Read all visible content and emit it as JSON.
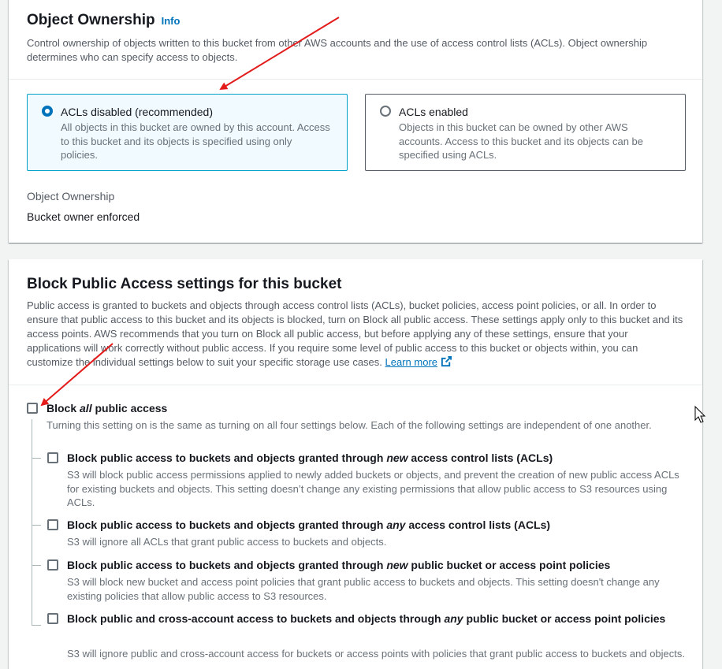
{
  "ownership": {
    "title": "Object Ownership",
    "info_label": "Info",
    "description": "Control ownership of objects written to this bucket from other AWS accounts and the use of access control lists (ACLs). Object ownership determines who can specify access to objects.",
    "options": [
      {
        "label": "ACLs disabled (recommended)",
        "description": "All objects in this bucket are owned by this account. Access to this bucket and its objects is specified using only policies.",
        "selected": true
      },
      {
        "label": "ACLs enabled",
        "description": "Objects in this bucket can be owned by other AWS accounts. Access to this bucket and its objects can be specified using ACLs.",
        "selected": false
      }
    ],
    "setting_label": "Object Ownership",
    "setting_value": "Bucket owner enforced"
  },
  "bpa": {
    "title": "Block Public Access settings for this bucket",
    "description": "Public access is granted to buckets and objects through access control lists (ACLs), bucket policies, access point policies, or all. In order to ensure that public access to this bucket and its objects is blocked, turn on Block all public access. These settings apply only to this bucket and its access points. AWS recommends that you turn on Block all public access, but before applying any of these settings, ensure that your applications will work correctly without public access. If you require some level of public access to this bucket or objects within, you can customize the individual settings below to suit your specific storage use cases.",
    "learn_more": "Learn more",
    "block_all": {
      "label_pre": "Block ",
      "label_em": "all",
      "label_post": " public access",
      "description": "Turning this setting on is the same as turning on all four settings below. Each of the following settings are independent of one another.",
      "checked": false
    },
    "options": [
      {
        "label_pre": "Block public access to buckets and objects granted through ",
        "label_em": "new",
        "label_post": " access control lists (ACLs)",
        "description": "S3 will block public access permissions applied to newly added buckets or objects, and prevent the creation of new public access ACLs for existing buckets and objects. This setting doesn’t change any existing permissions that allow public access to S3 resources using ACLs.",
        "checked": false
      },
      {
        "label_pre": "Block public access to buckets and objects granted through ",
        "label_em": "any",
        "label_post": " access control lists (ACLs)",
        "description": "S3 will ignore all ACLs that grant public access to buckets and objects.",
        "checked": false
      },
      {
        "label_pre": "Block public access to buckets and objects granted through ",
        "label_em": "new",
        "label_post": " public bucket or access point policies",
        "description": "S3 will block new bucket and access point policies that grant public access to buckets and objects. This setting doesn't change any existing policies that allow public access to S3 resources.",
        "checked": false
      },
      {
        "label_pre": "Block public and cross-account access to buckets and objects through ",
        "label_em": "any",
        "label_post": " public bucket or access point policies",
        "description": "S3 will ignore public and cross-account access for buckets or access points with policies that grant public access to buckets and objects.",
        "checked": false
      }
    ]
  },
  "colors": {
    "link": "#0073bb",
    "selected_border": "#00a1c9",
    "selected_bg": "#f1faff",
    "annotation_arrow": "#e31b1b"
  },
  "icons": [
    "external-link-icon",
    "mouse-cursor-icon",
    "annotation-arrow"
  ]
}
